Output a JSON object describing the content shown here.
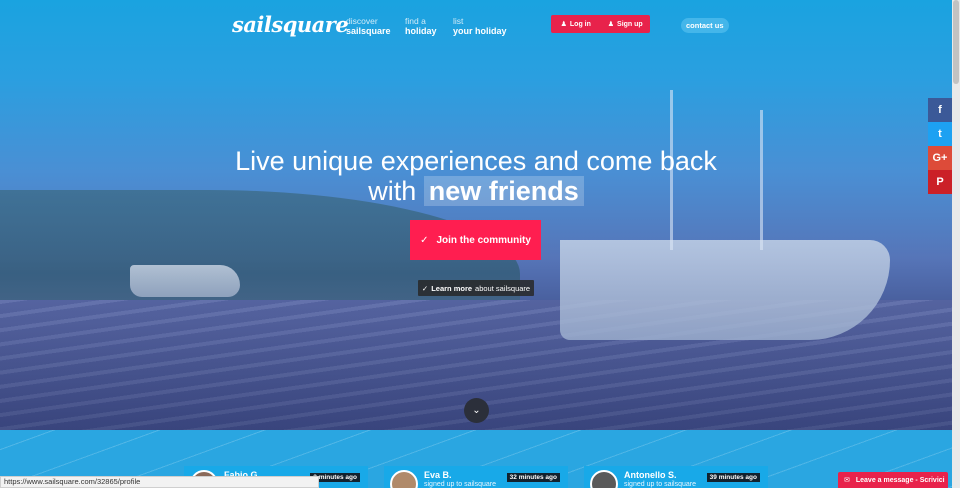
{
  "header": {
    "logo": "sailsquare",
    "nav": [
      {
        "small": "discover",
        "big": "sailsquare"
      },
      {
        "small": "find a",
        "big": "holiday"
      },
      {
        "small": "list",
        "big": "your holiday"
      }
    ],
    "login": "Log in",
    "signup": "Sign up",
    "contact": "contact us"
  },
  "hero": {
    "line1": "Live unique experiences and come back",
    "line2_prefix": "with",
    "line2_highlight": "new friends",
    "join": "Join the community",
    "learn_bold": "Learn more",
    "learn_rest": "about sailsquare"
  },
  "social": [
    {
      "icon": "facebook-icon",
      "glyph": "f",
      "color": "#3b5998"
    },
    {
      "icon": "twitter-icon",
      "glyph": "t",
      "color": "#1da1f2"
    },
    {
      "icon": "google-plus-icon",
      "glyph": "G+",
      "color": "#dd4b39"
    },
    {
      "icon": "pinterest-icon",
      "glyph": "P",
      "color": "#cb2027"
    }
  ],
  "activity": [
    {
      "name": "Fabio G.",
      "sub": "",
      "time": "3 minutes ago"
    },
    {
      "name": "Eva B.",
      "sub": "signed up to sailsquare",
      "time": "32 minutes ago"
    },
    {
      "name": "Antonello S.",
      "sub": "signed up to sailsquare",
      "time": "39 minutes ago"
    }
  ],
  "status_url": "https://www.sailsquare.com/32865/profile",
  "chat_label": "Leave a message - Scrivici"
}
